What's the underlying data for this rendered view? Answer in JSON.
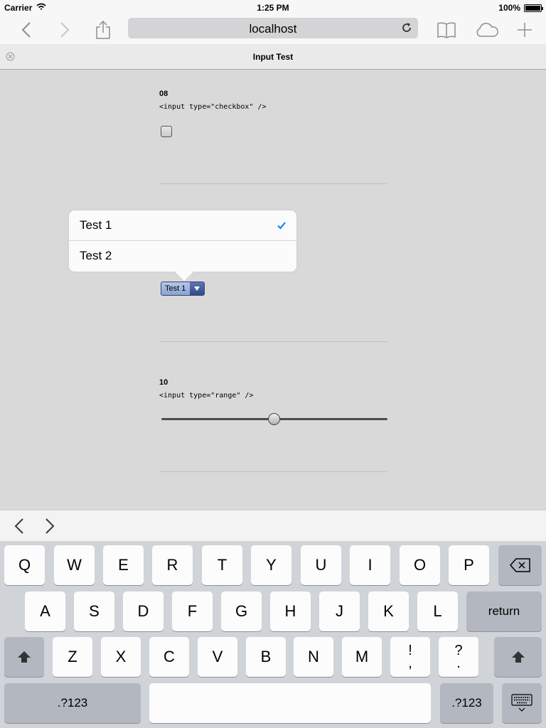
{
  "status_bar": {
    "carrier": "Carrier",
    "time": "1:25 PM",
    "battery": "100%"
  },
  "browser": {
    "url": "localhost",
    "tab_title": "Input Test",
    "icons": [
      "back-icon",
      "forward-icon",
      "share-icon",
      "reload-icon",
      "bookmarks-icon",
      "icloud-tabs-icon",
      "new-tab-icon",
      "close-tab-icon"
    ]
  },
  "sections": [
    {
      "number": "08",
      "code": "<input type=\"checkbox\" />"
    },
    {
      "number": "10",
      "code": "<input type=\"range\" />"
    }
  ],
  "controls": {
    "checkbox_checked": false,
    "select_value": "Test 1",
    "range_value": 0.5
  },
  "popover": {
    "options": [
      {
        "label": "Test 1",
        "selected": true
      },
      {
        "label": "Test 2",
        "selected": false
      }
    ]
  },
  "keyboard": {
    "row1": [
      "Q",
      "W",
      "E",
      "R",
      "T",
      "Y",
      "U",
      "I",
      "O",
      "P"
    ],
    "row2": [
      "A",
      "S",
      "D",
      "F",
      "G",
      "H",
      "J",
      "K",
      "L"
    ],
    "row3": [
      "Z",
      "X",
      "C",
      "V",
      "B",
      "N",
      "M"
    ],
    "punct1": [
      "!",
      ","
    ],
    "punct2": [
      "?",
      "."
    ],
    "return_label": "return",
    "numbers_label": ".?123"
  },
  "colors": {
    "accent": "#007aff",
    "page_bg": "#d9d9d9",
    "keyboard_bg": "#d0d3d8"
  }
}
